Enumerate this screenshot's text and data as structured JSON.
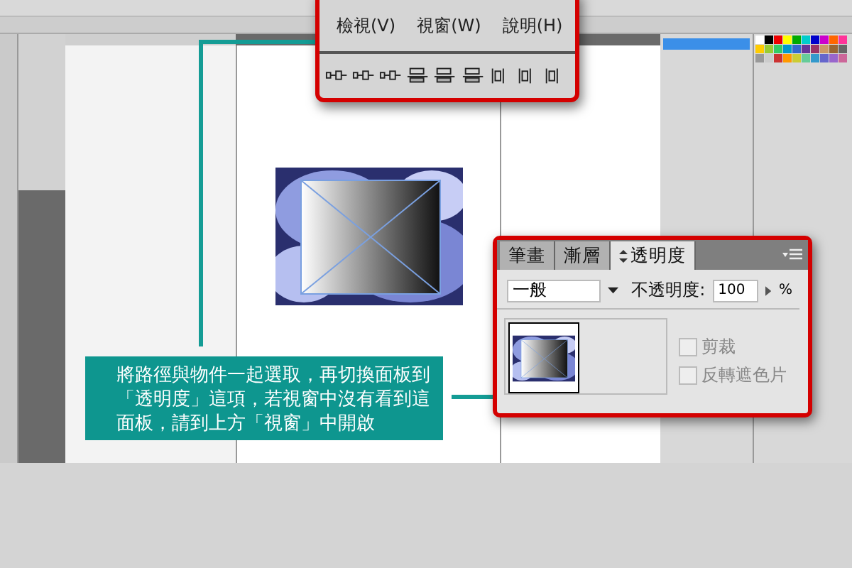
{
  "menu_callout": {
    "menus": [
      {
        "label": "檢視(V)"
      },
      {
        "label": "視窗(W)"
      },
      {
        "label": "說明(H)"
      }
    ]
  },
  "transparency_panel": {
    "tabs": [
      {
        "label": "筆畫",
        "selected": false
      },
      {
        "label": "漸層",
        "selected": false
      },
      {
        "label": "透明度",
        "selected": true
      }
    ],
    "blend_mode": "一般",
    "opacity_label": "不透明度:",
    "opacity": "100",
    "percent": "%",
    "options": [
      {
        "label": "剪裁",
        "checked": false
      },
      {
        "label": "反轉遮色片",
        "checked": false
      }
    ]
  },
  "caption": "將路徑與物件一起選取，再切換面板到「透明度」這項，若視窗中沒有看到這面板，請到上方「視窗」中開啟"
}
